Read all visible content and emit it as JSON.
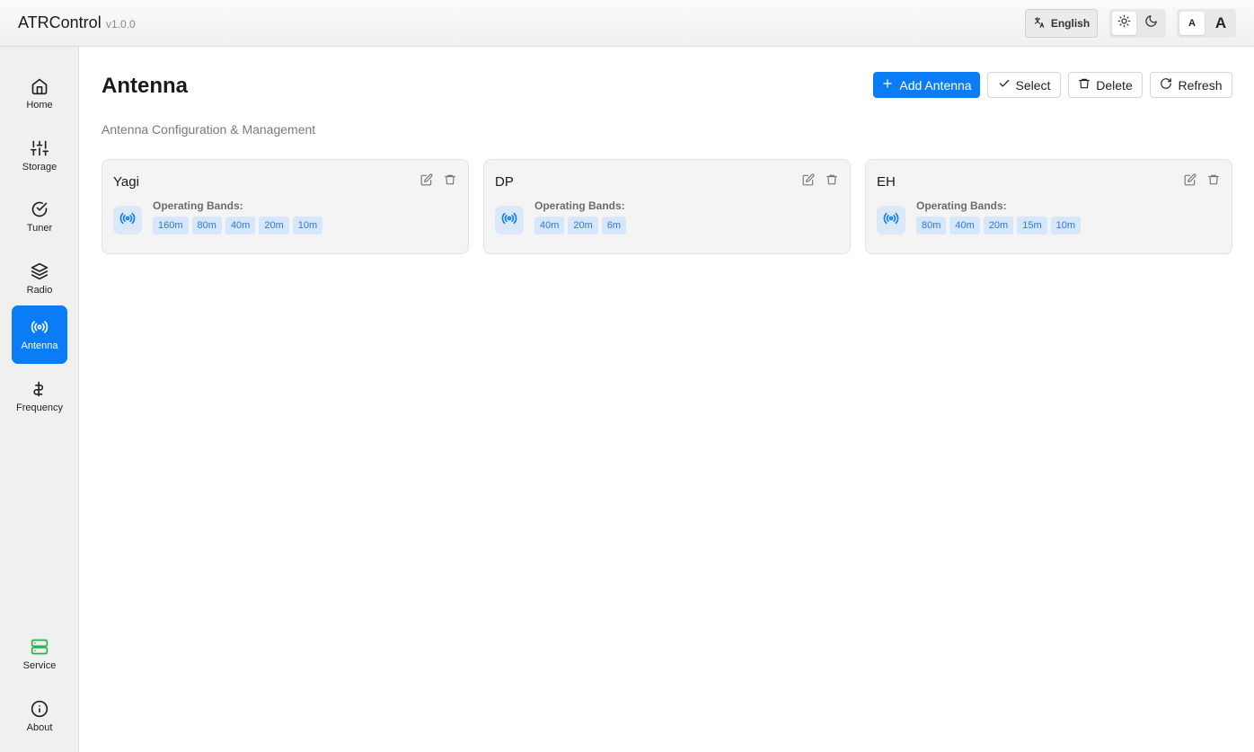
{
  "header": {
    "title": "ATRControl",
    "version": "v1.0.0",
    "language_label": "English",
    "font_small_label": "A",
    "font_large_label": "A"
  },
  "sidebar": {
    "items": [
      {
        "label": "Home",
        "icon": "home-icon"
      },
      {
        "label": "Storage",
        "icon": "sliders-icon"
      },
      {
        "label": "Tuner",
        "icon": "check-circle-icon"
      },
      {
        "label": "Radio",
        "icon": "layers-icon"
      },
      {
        "label": "Antenna",
        "icon": "broadcast-icon",
        "active": true
      },
      {
        "label": "Frequency",
        "icon": "frequency-icon"
      }
    ],
    "bottom_items": [
      {
        "label": "Service",
        "icon": "server-icon"
      },
      {
        "label": "About",
        "icon": "info-icon"
      }
    ]
  },
  "page": {
    "title": "Antenna",
    "subtitle": "Antenna Configuration & Management"
  },
  "toolbar": {
    "add_label": "Add Antenna",
    "select_label": "Select",
    "delete_label": "Delete",
    "refresh_label": "Refresh"
  },
  "antennas": [
    {
      "name": "Yagi",
      "bands_label": "Operating Bands:",
      "bands": [
        "160m",
        "80m",
        "40m",
        "20m",
        "10m"
      ]
    },
    {
      "name": "DP",
      "bands_label": "Operating Bands:",
      "bands": [
        "40m",
        "20m",
        "6m"
      ]
    },
    {
      "name": "EH",
      "bands_label": "Operating Bands:",
      "bands": [
        "80m",
        "40m",
        "20m",
        "15m",
        "10m"
      ]
    }
  ],
  "colors": {
    "accent": "#0a7cf5",
    "service_icon": "#2bb24c",
    "chip_bg": "#d6e6fb",
    "chip_text": "#2f78d6"
  }
}
